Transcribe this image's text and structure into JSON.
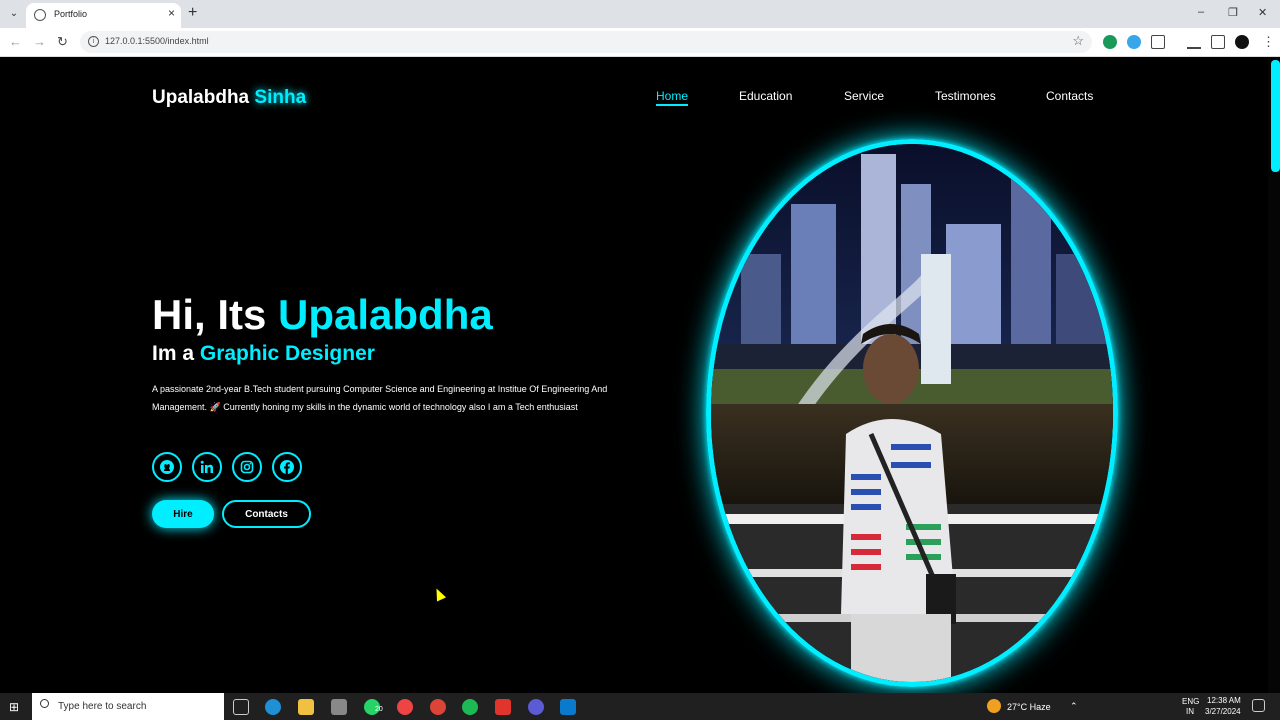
{
  "browser": {
    "tab_title": "Portfolio",
    "url": "127.0.0.1:5500/index.html"
  },
  "site": {
    "logo_first": "Upalabdha",
    "logo_accent": "Sinha",
    "nav": [
      "Home",
      "Education",
      "Service",
      "Testimones",
      "Contacts"
    ],
    "greeting": "Hi, Its ",
    "greeting_name": "Upalabdha",
    "role_prefix": "Im a ",
    "role": "Graphic Designer",
    "bio": "A passionate 2nd-year B.Tech student pursuing Computer Science and Engineering at Institue Of Engineering And Management. 🚀 Currently honing my skills in the dynamic world of technology also I am a Tech enthusiast",
    "social_icons": [
      "github-icon",
      "linkedin-icon",
      "instagram-icon",
      "facebook-icon"
    ],
    "hire_label": "Hire",
    "contacts_label": "Contacts",
    "accent_color": "#00eeff"
  },
  "taskbar": {
    "search_placeholder": "Type here to search",
    "weather": "27°C  Haze",
    "lang_top": "ENG",
    "lang_bottom": "IN",
    "time": "12:38 AM",
    "date": "3/27/2024",
    "whatsapp_badge": "20"
  }
}
